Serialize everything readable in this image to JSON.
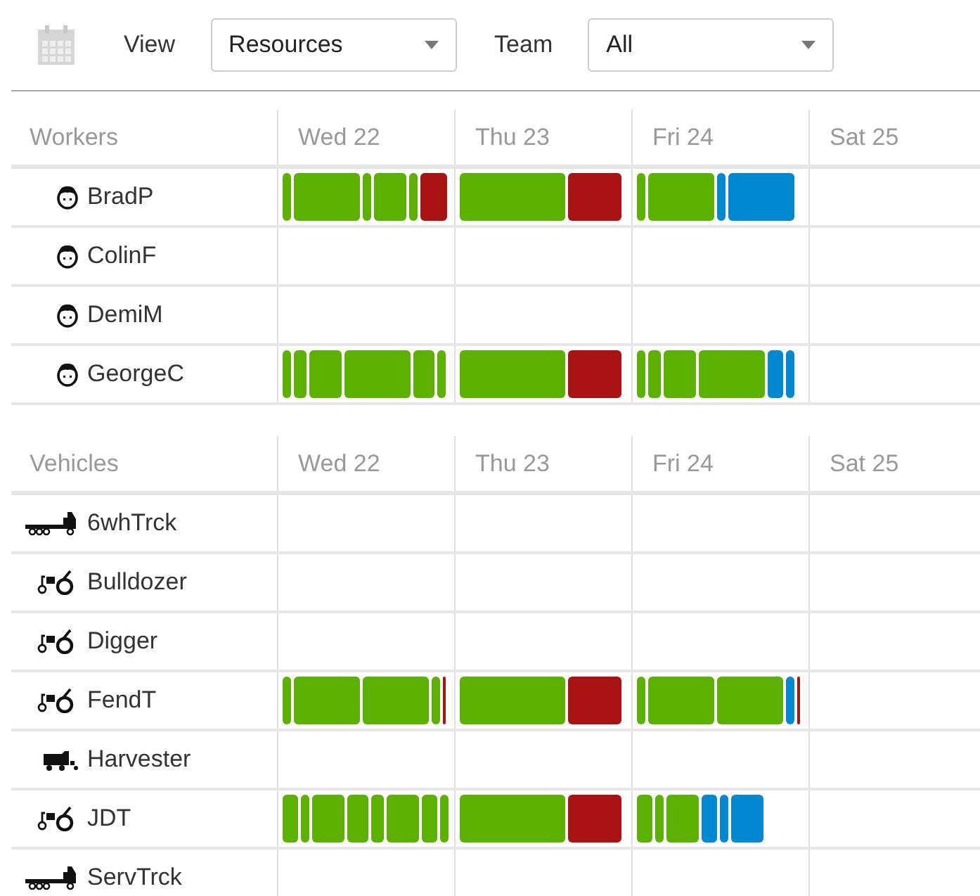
{
  "toolbar": {
    "view_label": "View",
    "view": "Resources",
    "team_label": "Team",
    "team": "All"
  },
  "groups": [
    {
      "title": "Workers",
      "columns": [
        "Wed 22",
        "Thu 23",
        "Fri 24",
        "Sat 25"
      ],
      "rows": [
        {
          "name": "BradP",
          "kind": "person",
          "days": [
            [
              {
                "color": "#5cb000",
                "kind": "tiny"
              },
              {
                "color": "#5cb000",
                "kind": "long"
              },
              {
                "color": "#5cb000",
                "kind": "tiny"
              },
              {
                "color": "#5cb000",
                "kind": "medium"
              },
              {
                "color": "#5cb000",
                "kind": "tiny"
              },
              {
                "color": "#a81313",
                "kind": "quarter"
              }
            ],
            [
              {
                "color": "#5cb000",
                "kind": "wide"
              },
              {
                "color": "#a81313",
                "kind": "half"
              }
            ],
            [
              {
                "color": "#5cb000",
                "kind": "tiny"
              },
              {
                "color": "#5cb000",
                "kind": "long"
              },
              {
                "color": "#0288d1",
                "kind": "tiny"
              },
              {
                "color": "#0288d1",
                "kind": "long"
              }
            ]
          ]
        },
        {
          "name": "ColinF",
          "kind": "person"
        },
        {
          "name": "DemiM",
          "kind": "person"
        },
        {
          "name": "GeorgeC",
          "kind": "person",
          "days": [
            [
              {
                "color": "#5cb000",
                "kind": "tiny"
              },
              {
                "color": "#5cb000",
                "kind": "narrow"
              },
              {
                "color": "#5cb000",
                "kind": "medium"
              },
              {
                "color": "#5cb000",
                "kind": "long"
              },
              {
                "color": "#5cb000",
                "kind": "short"
              },
              {
                "color": "#5cb000",
                "kind": "tiny"
              }
            ],
            [
              {
                "color": "#5cb000",
                "kind": "wide"
              },
              {
                "color": "#a81313",
                "kind": "half"
              }
            ],
            [
              {
                "color": "#5cb000",
                "kind": "tiny"
              },
              {
                "color": "#5cb000",
                "kind": "narrow"
              },
              {
                "color": "#5cb000",
                "kind": "medium"
              },
              {
                "color": "#5cb000",
                "kind": "long"
              },
              {
                "color": "#0288d1",
                "kind": "small"
              },
              {
                "color": "#0288d1",
                "kind": "tiny"
              }
            ]
          ]
        }
      ]
    },
    {
      "title": "Vehicles",
      "columns": [
        "Wed 22",
        "Thu 23",
        "Fri 24",
        "Sat 25"
      ],
      "rows": [
        {
          "name": "6whTrck",
          "kind": "truck"
        },
        {
          "name": "Bulldozer",
          "kind": "tractor"
        },
        {
          "name": "Digger",
          "kind": "tractor"
        },
        {
          "name": "FendT",
          "kind": "tractor",
          "days": [
            [
              {
                "color": "#5cb000",
                "kind": "tiny"
              },
              {
                "color": "#5cb000",
                "kind": "long"
              },
              {
                "color": "#5cb000",
                "kind": "long"
              },
              {
                "color": "#5cb000",
                "kind": "tiny"
              },
              {
                "color": "#a81313",
                "kind": "sliver"
              }
            ],
            [
              {
                "color": "#5cb000",
                "kind": "wide"
              },
              {
                "color": "#a81313",
                "kind": "half"
              }
            ],
            [
              {
                "color": "#5cb000",
                "kind": "tiny"
              },
              {
                "color": "#5cb000",
                "kind": "long"
              },
              {
                "color": "#5cb000",
                "kind": "long"
              },
              {
                "color": "#0288d1",
                "kind": "tiny"
              },
              {
                "color": "#a81313",
                "kind": "sliver"
              }
            ]
          ]
        },
        {
          "name": "Harvester",
          "kind": "harvester"
        },
        {
          "name": "JDT",
          "kind": "tractor",
          "days": [
            [
              {
                "color": "#5cb000",
                "kind": "small"
              },
              {
                "color": "#5cb000",
                "kind": "tiny"
              },
              {
                "color": "#5cb000",
                "kind": "medium"
              },
              {
                "color": "#5cb000",
                "kind": "short"
              },
              {
                "color": "#5cb000",
                "kind": "narrow"
              },
              {
                "color": "#5cb000",
                "kind": "medium"
              },
              {
                "color": "#5cb000",
                "kind": "small"
              },
              {
                "color": "#5cb000",
                "kind": "tiny"
              }
            ],
            [
              {
                "color": "#5cb000",
                "kind": "wide"
              },
              {
                "color": "#a81313",
                "kind": "half"
              }
            ],
            [
              {
                "color": "#5cb000",
                "kind": "small"
              },
              {
                "color": "#5cb000",
                "kind": "tiny"
              },
              {
                "color": "#5cb000",
                "kind": "medium"
              },
              {
                "color": "#0288d1",
                "kind": "small"
              },
              {
                "color": "#0288d1",
                "kind": "tiny"
              },
              {
                "color": "#0288d1",
                "kind": "medium"
              }
            ]
          ]
        },
        {
          "name": "ServTrck",
          "kind": "truck"
        }
      ]
    }
  ]
}
